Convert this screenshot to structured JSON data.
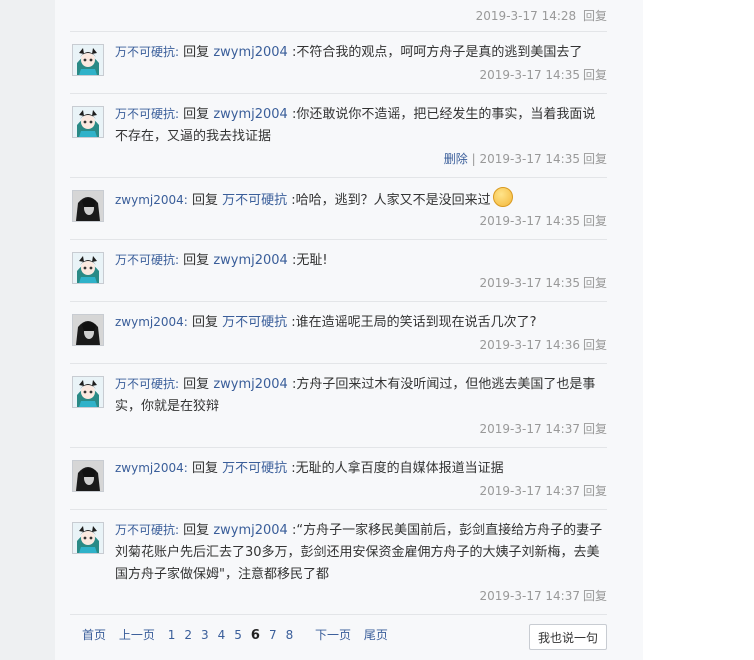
{
  "top_meta": {
    "time": "2019-3-17 14:28",
    "reply": "回复"
  },
  "comments": [
    {
      "user": "万不可硬抗:",
      "verb": "回复",
      "target": "zwymj2004",
      "text": ":不符合我的观点，呵呵方舟子是真的逃到美国去了",
      "delete": "",
      "time": "2019-3-17 14:35",
      "reply": "回复",
      "avatar": "anime-avatar-icon"
    },
    {
      "user": "万不可硬抗:",
      "verb": "回复",
      "target": "zwymj2004",
      "text": ":你还敢说你不造谣，把已经发生的事实，当着我面说不存在，又逼的我去找证据",
      "delete": "删除",
      "time": "2019-3-17 14:35",
      "reply": "回复",
      "avatar": "anime-avatar-icon"
    },
    {
      "user": "zwymj2004:",
      "verb": "回复",
      "target": "万不可硬抗",
      "text": ":哈哈，逃到？人家又不是没回来过",
      "delete": "",
      "time": "2019-3-17 14:35",
      "reply": "回复",
      "avatar": "dark-avatar-icon"
    },
    {
      "user": "万不可硬抗:",
      "verb": "回复",
      "target": "zwymj2004",
      "text": ":无耻!",
      "delete": "",
      "time": "2019-3-17 14:35",
      "reply": "回复",
      "avatar": "anime-avatar-icon"
    },
    {
      "user": "zwymj2004:",
      "verb": "回复",
      "target": "万不可硬抗",
      "text": ":谁在造谣呢王局的笑话到现在说舌几次了?",
      "delete": "",
      "time": "2019-3-17 14:36",
      "reply": "回复",
      "avatar": "dark-avatar-icon"
    },
    {
      "user": "万不可硬抗:",
      "verb": "回复",
      "target": "zwymj2004",
      "text": ":方舟子回来过木有没听闻过，但他逃去美国了也是事实，你就是在狡辩",
      "delete": "",
      "time": "2019-3-17 14:37",
      "reply": "回复",
      "avatar": "anime-avatar-icon"
    },
    {
      "user": "zwymj2004:",
      "verb": "回复",
      "target": "万不可硬抗",
      "text": ":无耻的人拿百度的自媒体报道当证据",
      "delete": "",
      "time": "2019-3-17 14:37",
      "reply": "回复",
      "avatar": "dark-avatar-icon"
    },
    {
      "user": "万不可硬抗:",
      "verb": "回复",
      "target": "zwymj2004",
      "text": ":“方舟子一家移民美国前后，彭剑直接给方舟子的妻子刘菊花账户先后汇去了30多万，彭剑还用安保资金雇佣方舟子的大姨子刘新梅，去美国方舟子家做保姆\"，注意都移民了都",
      "delete": "",
      "time": "2019-3-17 14:37",
      "reply": "回复",
      "avatar": "anime-avatar-icon"
    }
  ],
  "pagination": {
    "first": "首页",
    "prev": "上一页",
    "pages": [
      "1",
      "2",
      "3",
      "4",
      "5",
      "6",
      "7",
      "8"
    ],
    "current": "6",
    "next": "下一页",
    "last": "尾页"
  },
  "say_button": "我也说一句"
}
